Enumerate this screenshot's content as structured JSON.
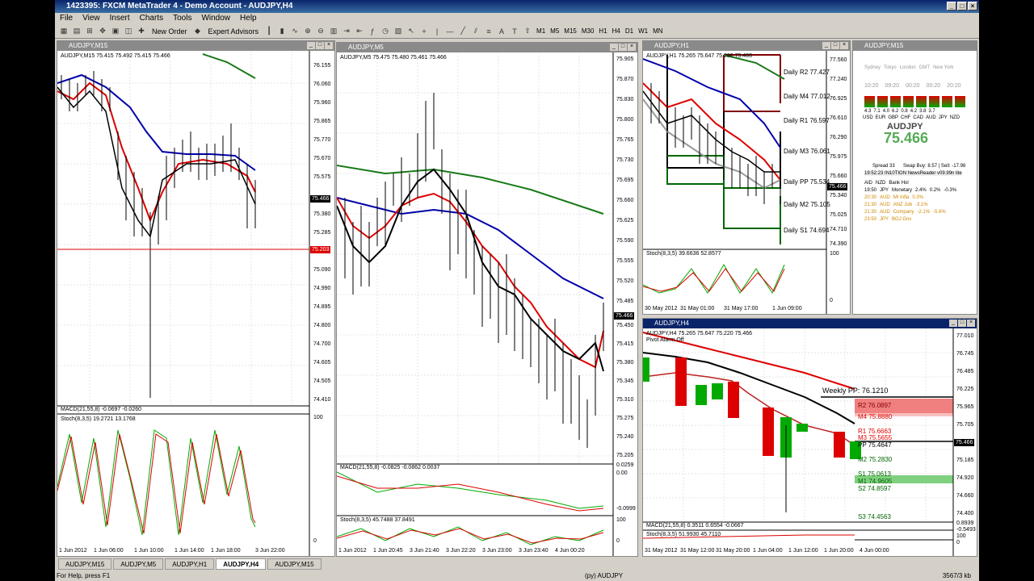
{
  "app": {
    "title": "1423395: FXCM MetaTrader 4 - Demo Account - AUDJPY,H4"
  },
  "menu": [
    "File",
    "View",
    "Insert",
    "Charts",
    "Tools",
    "Window",
    "Help"
  ],
  "toolbar": {
    "new_order": "New Order",
    "expert_advisors": "Expert Advisors",
    "timeframes": [
      "M1",
      "M5",
      "M15",
      "M30",
      "H1",
      "H4",
      "D1",
      "W1",
      "MN"
    ]
  },
  "charts": {
    "m15": {
      "title": "AUDJPY,M15",
      "info": "AUDJPY,M15  75.415 75.492 75.415 75.466",
      "price": "75.466",
      "red_line": "75.203",
      "yticks": [
        "76.155",
        "76.060",
        "75.960",
        "75.865",
        "75.770",
        "75.670",
        "75.575",
        "75.475",
        "75.380",
        "75.285",
        "75.190",
        "75.090",
        "74.990",
        "74.895",
        "74.800",
        "74.700",
        "74.605",
        "74.505",
        "74.410"
      ],
      "macd": "MACD(21,55,8) -0.0697 -0.0260",
      "stoch": "Stoch(8,3,5) 19.2721 13.1768",
      "stoch_ticks": [
        "100",
        "0"
      ],
      "xticks": [
        "1 Jun 2012",
        "1 Jun 06:00",
        "1 Jun 10:00",
        "1 Jun 14:00",
        "1 Jun 18:00",
        "3 Jun 22:00"
      ]
    },
    "m5": {
      "title": "AUDJPY,M5",
      "info": "AUDJPY,M5  75.475 75.480 75.461 75.466",
      "price": "75.466",
      "yticks": [
        "75.905",
        "75.870",
        "75.830",
        "75.800",
        "75.765",
        "75.730",
        "75.695",
        "75.660",
        "75.625",
        "75.590",
        "75.555",
        "75.520",
        "75.485",
        "75.450",
        "75.415",
        "75.380",
        "75.345",
        "75.310",
        "75.275",
        "75.240",
        "75.205"
      ],
      "macd": "MACD(21,55,8) -0.0825 -0.0862 0.0037",
      "macd_ticks": [
        "0.0259",
        "0.00",
        "-0.0999"
      ],
      "stoch": "Stoch(8,3,5) 45.7488 37.8491",
      "stoch_ticks": [
        "100",
        "0"
      ],
      "xticks": [
        "1 Jun 2012",
        "1 Jun 20:45",
        "3 Jun 21:40",
        "3 Jun 22:20",
        "3 Jun 23:00",
        "3 Jun 23:40",
        "4 Jun 00:20"
      ]
    },
    "h1": {
      "title": "AUDJPY,H1",
      "info": "AUDJPY,H1  75.265 75.647 75.280 75.466",
      "price": "75.466",
      "yticks": [
        "77.560",
        "77.240",
        "76.925",
        "76.610",
        "76.290",
        "75.975",
        "75.660",
        "75.340",
        "75.025",
        "74.710",
        "74.390"
      ],
      "pivots": [
        "Daily R2 77.427",
        "Daily M4 77.012",
        "Daily R1 76.597",
        "Daily M3 76.061",
        "Daily PP 75.534",
        "Daily M2 75.105",
        "Daily S1 74.694"
      ],
      "stoch": "Stoch(8,3,5) 39.6636 52.8577",
      "stoch_ticks": [
        "100",
        "0"
      ],
      "xticks": [
        "30 May 2012",
        "31 May 01:00",
        "31 May 17:00",
        "1 Jun 09:00"
      ]
    },
    "h4": {
      "title": "AUDJPY,H4",
      "info": "AUDJPY,H4  75.265 75.647 75.220 75.466",
      "pivot_alarm": "Pivot Alarm Off",
      "price": "75.466",
      "yticks": [
        "77.010",
        "76.745",
        "76.485",
        "76.225",
        "75.965",
        "75.705",
        "75.445",
        "75.185",
        "74.920",
        "74.660",
        "74.400"
      ],
      "weekly": "Weekly PP: 76.1210",
      "levels": [
        "R2 76.0897",
        "M4 75.8880",
        "R1 75.6663",
        "M3 75.5655",
        "PP 75.4647",
        "M2 75.2830",
        "S1 75.0613",
        "M1 74.9605",
        "S2 74.8597",
        "S3 74.4563"
      ],
      "macd": "MACD(21,55,8) 0.3511 0.6554 -0.0667",
      "macd_ticks": [
        "0.8939",
        "-0.5493"
      ],
      "stoch": "Stoch(8,3,5) 51.9930 45.7110",
      "stoch_ticks": [
        "100",
        "0"
      ],
      "xticks": [
        "31 May 2012",
        "31 May 12:00",
        "31 May 20:00",
        "1 Jun 04:00",
        "1 Jun 12:00",
        "1 Jun 20:00",
        "4 Jun 00:00"
      ]
    },
    "widget": {
      "title": "AUDJPY,M15",
      "cities": [
        "Sydney",
        "Tokyo",
        "London",
        "GMT",
        "New York"
      ],
      "times": [
        "10:20",
        "09:20",
        "00:20",
        "00:20",
        "20:20"
      ],
      "currencies": [
        "USD",
        "EUR",
        "GBP",
        "CHF",
        "CAD",
        "AUD",
        "JPY",
        "NZD"
      ],
      "strengths": [
        "4.3",
        "7.1",
        "4.0",
        "6.2",
        "0.8",
        "4.2",
        "3.8",
        "3.7"
      ],
      "pair": "AUDJPY",
      "price": "75.466",
      "spread": "Spread 33",
      "swap": "Swap Buy: 8.57 | Sell: -17.98",
      "newsreader": "19:52:23  IN10TION NewsReader v09.99n lite",
      "news": [
        [
          "AID",
          "NZD",
          "Bank Hol",
          "",
          "",
          ""
        ],
        [
          "19:50",
          "JPY",
          "Monetary",
          "2.4%",
          "0.2%",
          "-0.3%"
        ],
        [
          "20:30",
          "AUD",
          "MI Infla",
          "",
          "",
          "0.3%"
        ],
        [
          "21:30",
          "AUD",
          "ANZ Job",
          "",
          "",
          "-3.1%"
        ],
        [
          "21:30",
          "AUD",
          "Company",
          "",
          "-2.1%",
          "-5.6%"
        ],
        [
          "23:50",
          "JPY",
          "BOJ Gov",
          "",
          "",
          ""
        ]
      ]
    }
  },
  "tabs": [
    "AUDJPY,M15",
    "AUDJPY,M5",
    "AUDJPY,H1",
    "AUDJPY,H4",
    "AUDJPY,M15"
  ],
  "status": {
    "help": "For Help, press F1",
    "profile": "(py) AUDJPY",
    "traffic": "3567/3 kb"
  }
}
